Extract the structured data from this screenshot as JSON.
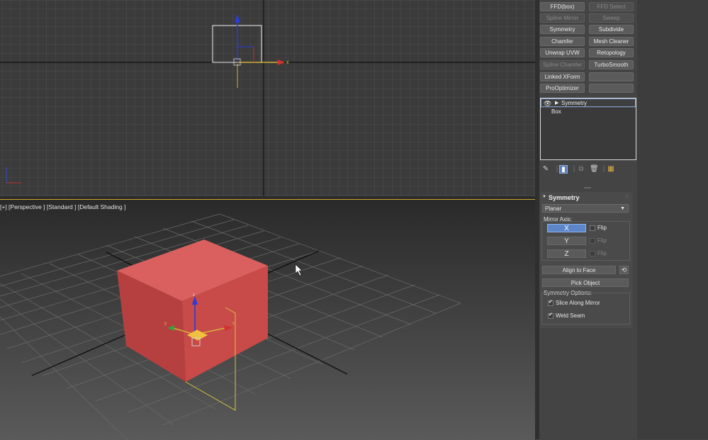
{
  "viewports": {
    "top_label": "",
    "perspective_label": "[+] [Perspective ] [Standard ] [Default Shading ]"
  },
  "modifier_list": [
    {
      "label": "FFD(box)",
      "disabled": false
    },
    {
      "label": "FFD Select",
      "disabled": true
    },
    {
      "label": "Spline Mirror",
      "disabled": true
    },
    {
      "label": "Sweep",
      "disabled": true
    },
    {
      "label": "Symmetry",
      "disabled": false
    },
    {
      "label": "Subdivide",
      "disabled": false
    },
    {
      "label": "Chamfer",
      "disabled": false
    },
    {
      "label": "Mesh Cleaner",
      "disabled": false
    },
    {
      "label": "Unwrap UVW",
      "disabled": false
    },
    {
      "label": "Retopology",
      "disabled": false
    },
    {
      "label": "Spline Chamfer",
      "disabled": true
    },
    {
      "label": "TurboSmooth",
      "disabled": false
    },
    {
      "label": "Linked XForm",
      "disabled": false
    },
    {
      "label": "",
      "disabled": false
    },
    {
      "label": "ProOptimizer",
      "disabled": false
    },
    {
      "label": "",
      "disabled": false
    }
  ],
  "stack": {
    "items": [
      "Symmetry",
      "Box"
    ]
  },
  "rollout": {
    "title": "Symmetry",
    "dropdown_value": "Planar",
    "mirror_axis_label": "Mirror Axis:",
    "axes": [
      "X",
      "Y",
      "Z"
    ],
    "flip_label": "Flip",
    "align_to_face": "Align to Face",
    "pick_object": "Pick Object",
    "options_label": "Symmetry Options:",
    "slice_along_mirror": "Slice Along Mirror",
    "weld_seam": "Weld Seam"
  },
  "gizmo_labels": {
    "x": "x",
    "y": "y",
    "z": "z"
  },
  "colors": {
    "box_face": "#c8504f",
    "selection_border": "#c9a62a",
    "active_blue": "#5d86c8"
  }
}
